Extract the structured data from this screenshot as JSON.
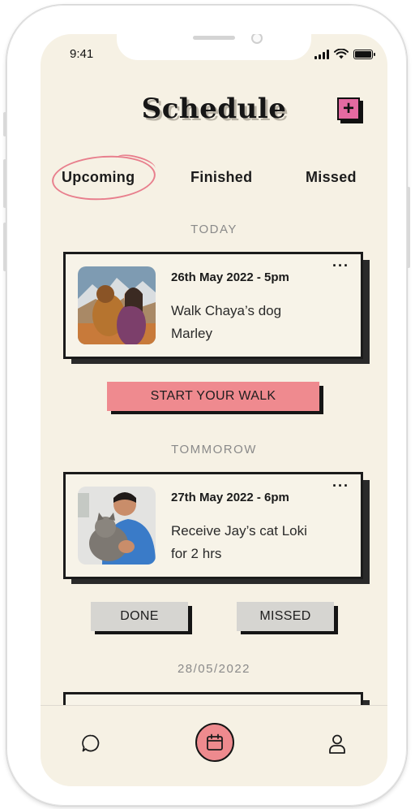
{
  "status_bar": {
    "time": "9:41"
  },
  "header": {
    "title": "Schedule",
    "add_button": "+"
  },
  "tabs": [
    {
      "label": "Upcoming",
      "active": true
    },
    {
      "label": "Finished",
      "active": false
    },
    {
      "label": "Missed",
      "active": false
    }
  ],
  "sections": [
    {
      "heading": "TODAY",
      "card": {
        "date": "26th May 2022 - 5pm",
        "description": "Walk Chaya’s dog Marley",
        "menu": "···",
        "icon": "dog-photo"
      },
      "actions": [
        {
          "label": "START YOUR WALK"
        }
      ]
    },
    {
      "heading": "TOMMOROW",
      "card": {
        "date": "27th May 2022 - 6pm",
        "description": "Receive Jay’s cat Loki for 2 hrs",
        "menu": "···",
        "icon": "cat-photo"
      },
      "actions": [
        {
          "label": "DONE"
        },
        {
          "label": "MISSED"
        }
      ]
    },
    {
      "heading": "28/05/2022"
    }
  ],
  "bottom_nav": [
    {
      "name": "chat",
      "icon": "chat-bubble-icon"
    },
    {
      "name": "calendar",
      "icon": "calendar-icon",
      "active": true
    },
    {
      "name": "profile",
      "icon": "user-icon"
    }
  ],
  "colors": {
    "background": "#f6f1e4",
    "accent_pink": "#ef8a8f",
    "add_pink": "#e46aa1",
    "ink": "#1b1b1b",
    "gray_button": "#d6d5d1"
  }
}
